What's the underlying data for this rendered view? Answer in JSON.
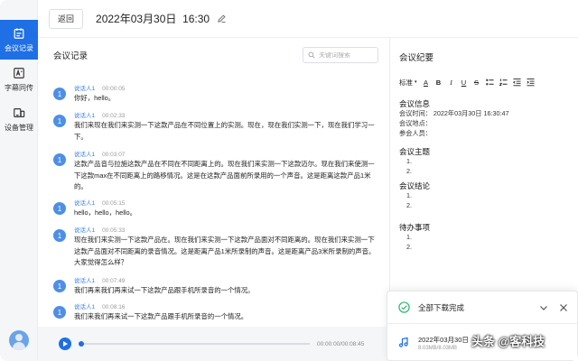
{
  "sidebar": {
    "items": [
      {
        "label": "会议记录",
        "icon": "calendar-icon",
        "active": true
      },
      {
        "label": "字幕同传",
        "icon": "translate-icon",
        "active": false
      },
      {
        "label": "设备管理",
        "icon": "devices-icon",
        "active": false
      }
    ]
  },
  "header": {
    "back_label": "返回",
    "title": "2022年03月30日  16:30"
  },
  "record": {
    "title": "会议记录",
    "search_placeholder": "关键词搜索",
    "messages": [
      {
        "speaker": "说话人1",
        "time": "00:00:05",
        "text": "你好，hello。"
      },
      {
        "speaker": "说话人1",
        "time": "00:02:33",
        "text": "我们来现在我们来实测一下这款产品在不同位置上的实测。现在，现在我们实测一下，现在我们学习一下。"
      },
      {
        "speaker": "说话人1",
        "time": "00:03:07",
        "text": "这款产品音与拉施这款产品在不同在不同距离上的。现在我们来实测一下这款迈尔。现在我们来使测一下这款max在不同距离上的路移情况。这是在这款产品面前所录用的一个声音。这是距离这款产品1米的。"
      },
      {
        "speaker": "说话人1",
        "time": "00:05:15",
        "text": "hello，hello，hello。"
      },
      {
        "speaker": "说话人1",
        "time": "00:05:33",
        "text": "现在我们来实测一下这款产品在。现在我们来实测一下这款产品面对不同距离的。现在我们来实测一下这款产品面对不同距离的录音情况。这是距离产品1米所录制的声音。这是距离产品3米所录制的声音。大家觉得怎么样？"
      },
      {
        "speaker": "说话人1",
        "time": "00:07:49",
        "text": "我们再来我们再来试一下这款产品跟手机所录音的一个情况。"
      },
      {
        "speaker": "说话人1",
        "time": "00:08:16",
        "text": "我们来我们再来试一下这款产品跟手机所录音的一个情况。"
      }
    ],
    "player": {
      "time": "00:00:00/00:08:45",
      "progress": 0
    }
  },
  "minutes": {
    "title": "会议纪要",
    "toolbar": [
      "标准",
      "A",
      "B",
      "I",
      "U",
      "S"
    ],
    "info_title": "会议信息",
    "info_lines": [
      "会议时间：  2022年03月30日 16:30:47",
      "会议地点：",
      "参会人员："
    ],
    "topic_title": "会议主题",
    "conclusion_title": "会议结论",
    "todo_title": "待办事项",
    "list_numbers": [
      "1.",
      "2."
    ]
  },
  "toast": {
    "title": "全部下载完成",
    "file_name": "2022年03月30日",
    "file_size": "8.03MB/8.03MB"
  },
  "watermark": "头条 @客科技",
  "colors": {
    "accent": "#1f6fe5",
    "speaker": "#3a7de0",
    "success": "#2bb673"
  }
}
